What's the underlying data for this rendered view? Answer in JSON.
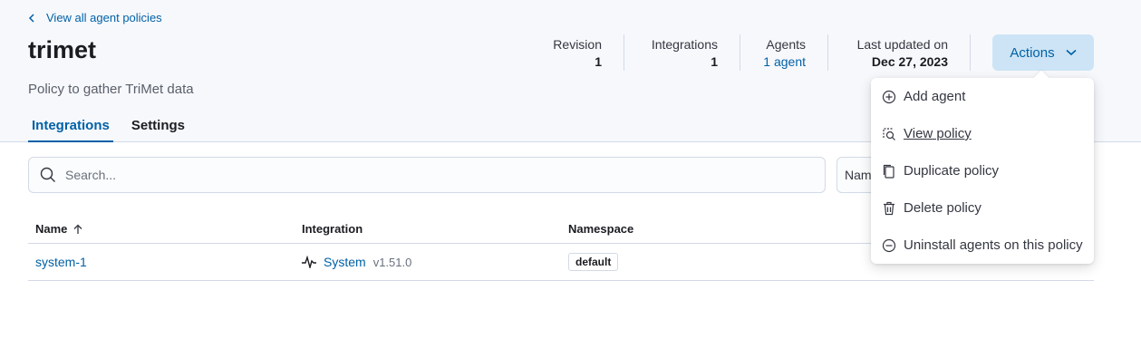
{
  "header": {
    "back_link": "View all agent policies",
    "title": "trimet",
    "description": "Policy to gather TriMet data"
  },
  "stats": {
    "revision_label": "Revision",
    "revision_value": "1",
    "integrations_label": "Integrations",
    "integrations_value": "1",
    "agents_label": "Agents",
    "agents_value": "1 agent",
    "updated_label": "Last updated on",
    "updated_value": "Dec 27, 2023"
  },
  "actions_label": "Actions",
  "tabs": [
    {
      "label": "Integrations",
      "active": true
    },
    {
      "label": "Settings",
      "active": false
    }
  ],
  "search": {
    "placeholder": "Search...",
    "value": ""
  },
  "namespace_filter_label": "Namespace",
  "table": {
    "columns": [
      "Name",
      "Integration",
      "Namespace"
    ],
    "rows": [
      {
        "name": "system-1",
        "integration": "System",
        "version": "v1.51.0",
        "namespace": "default"
      }
    ]
  },
  "menu": {
    "items": [
      {
        "label": "Add agent",
        "icon": "plus-in-circle-icon"
      },
      {
        "label": "View policy",
        "icon": "inspect-icon"
      },
      {
        "label": "Duplicate policy",
        "icon": "copy-icon"
      },
      {
        "label": "Delete policy",
        "icon": "trash-icon"
      },
      {
        "label": "Uninstall agents on this policy",
        "icon": "minus-in-circle-icon"
      }
    ]
  },
  "colors": {
    "accent": "#0061a6",
    "button_bg": "#cce4f5",
    "header_bg": "#f7f8fc",
    "border": "#d3dae6"
  }
}
